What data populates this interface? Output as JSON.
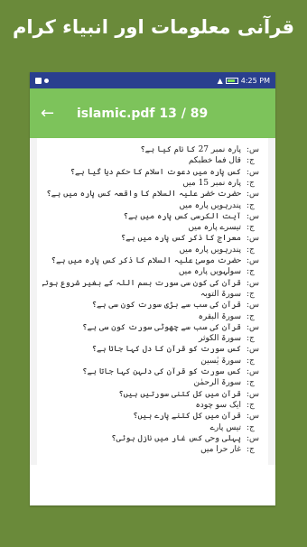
{
  "promo_title": "قرآنی معلومات اور انبیاء کرام",
  "status": {
    "time": "4:25 PM"
  },
  "toolbar": {
    "back_icon": "arrow-left-icon",
    "title": "islamic.pdf 13 / 89"
  },
  "colors": {
    "background": "#6a8a3a",
    "status_bar": "#2a3f8f",
    "app_bar": "#7dc35b"
  },
  "pdf": {
    "lines": [
      {
        "num": "س:",
        "text": "پارہ نمبر 27 کا نام کیا ہے؟"
      },
      {
        "num": "ج:",
        "text": "قال فما خطبکم"
      },
      {
        "num": "س:",
        "text": "کس پارہ میں دعوت اسلام کا حکم دیا گیا ہے؟"
      },
      {
        "num": "ج:",
        "text": "پارہ نمبر 15 میں"
      },
      {
        "num": "س:",
        "text": "حضرت خضر علیہ السلام کا واقعہ کس پارہ میں ہے؟"
      },
      {
        "num": "ج:",
        "text": "پندرہویں پارہ میں"
      },
      {
        "num": "س:",
        "text": "آیت الکرسی کس پارہ میں ہے؟"
      },
      {
        "num": "ج:",
        "text": "تیسرے پارہ میں"
      },
      {
        "num": "س:",
        "text": "معراج کا ذکر کس پارہ میں ہے؟"
      },
      {
        "num": "ج:",
        "text": "پندرہویں پارہ میں"
      },
      {
        "num": "س:",
        "text": "حضرت موسیٰ علیہ السلام کا ذکر کس پارہ میں ہے؟"
      },
      {
        "num": "ج:",
        "text": "سولہویں پارہ میں"
      },
      {
        "num": "س:",
        "text": "قرآن کی کون سی سورت بسم اللہ کے بغیر شروع ہوتی ہے؟"
      },
      {
        "num": "ج:",
        "text": "سورۃ التوبہ"
      },
      {
        "num": "س:",
        "text": "قرآن کی سب سے بڑی سورت کون سی ہے؟"
      },
      {
        "num": "ج:",
        "text": "سورۃ البقرہ"
      },
      {
        "num": "س:",
        "text": "قرآن کی سب سے چھوٹی سورت کون سی ہے؟"
      },
      {
        "num": "ج:",
        "text": "سورۃ الکوثر"
      },
      {
        "num": "س:",
        "text": "کس سورت کو قرآن کا دل کہا جاتا ہے؟"
      },
      {
        "num": "ج:",
        "text": "سورۃ یٰسین"
      },
      {
        "num": "س:",
        "text": "کس سورت کو قرآن کی دلہن کہا جاتا ہے؟"
      },
      {
        "num": "ج:",
        "text": "سورۃ الرحمٰن"
      },
      {
        "num": "س:",
        "text": "قرآن میں کل کتنی سورتیں ہیں؟"
      },
      {
        "num": "ج:",
        "text": "ایک سو چودہ"
      },
      {
        "num": "س:",
        "text": "قرآن میں کل کتنے پارے ہیں؟"
      },
      {
        "num": "ج:",
        "text": "تیس پارے"
      },
      {
        "num": "س:",
        "text": "پہلی وحی کس غار میں نازل ہوئی؟"
      },
      {
        "num": "ج:",
        "text": "غار حرا میں"
      }
    ]
  }
}
